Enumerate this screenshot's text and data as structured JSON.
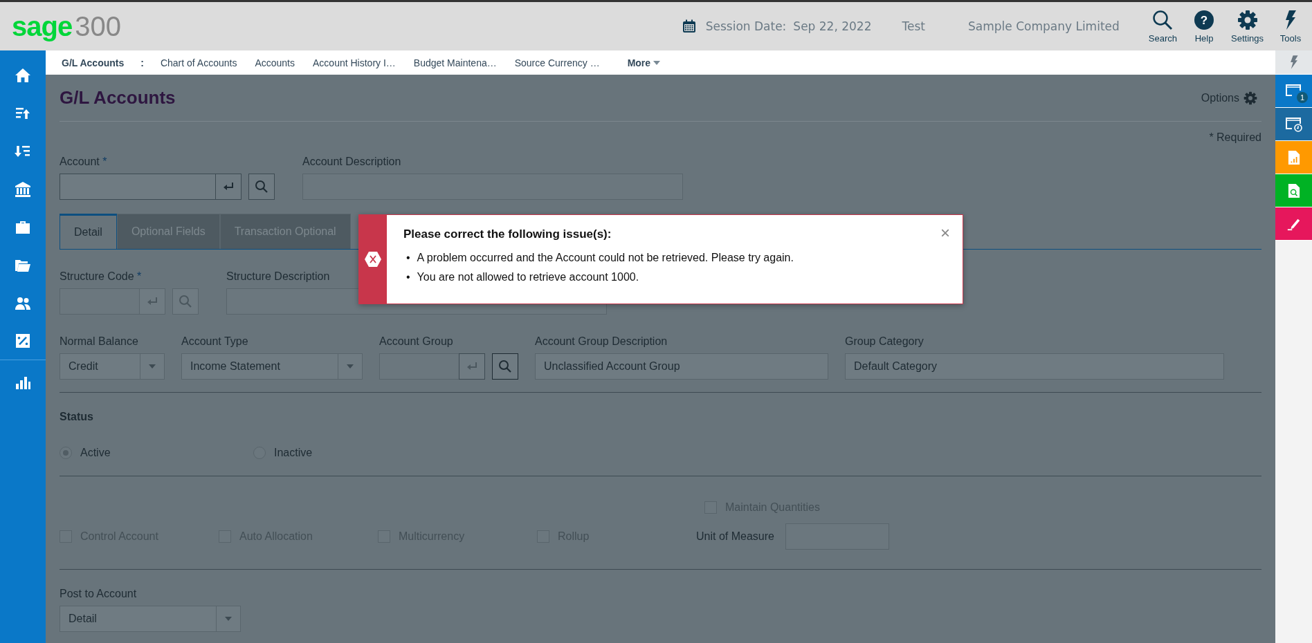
{
  "logo": {
    "brand": "sage",
    "product": "300"
  },
  "header": {
    "session_label": "Session Date:",
    "session_date": "Sep 22, 2022",
    "database": "Test",
    "company": "Sample Company Limited",
    "tools": [
      {
        "kind": "search",
        "label": "Search"
      },
      {
        "kind": "help",
        "label": "Help",
        "glyph": "?"
      },
      {
        "kind": "settings",
        "label": "Settings"
      },
      {
        "kind": "tools",
        "label": "Tools"
      }
    ]
  },
  "nav": {
    "module": "G/L Accounts",
    "separator": ":",
    "links": [
      "Chart of Accounts",
      "Accounts",
      "Account History I…",
      "Budget Maintena…",
      "Source Currency …"
    ],
    "more": "More"
  },
  "sidebar": {
    "items": [
      {
        "kind": "home"
      },
      {
        "kind": "upload"
      },
      {
        "kind": "download"
      },
      {
        "kind": "bank"
      },
      {
        "kind": "briefcase"
      },
      {
        "kind": "folders"
      },
      {
        "kind": "people"
      },
      {
        "kind": "percent"
      },
      {
        "kind": "chart"
      }
    ]
  },
  "right_panel": {
    "items": [
      {
        "kind": "bolt",
        "color": "#e4e7e9"
      },
      {
        "kind": "window",
        "color": "#0a78c8",
        "badge": "1"
      },
      {
        "kind": "window-clock",
        "color": "#1c6aa0"
      },
      {
        "kind": "report",
        "color": "#ff9900"
      },
      {
        "kind": "inquiry",
        "color": "#00b224"
      },
      {
        "kind": "pen",
        "color": "#e6175c"
      }
    ]
  },
  "page": {
    "title": "G/L Accounts",
    "options": "Options",
    "required_note": "* Required"
  },
  "account": {
    "label": "Account",
    "required": "*",
    "description_label": "Account Description"
  },
  "tabs": [
    {
      "label": "Detail",
      "selected": true
    },
    {
      "label": "Optional Fields",
      "selected": false
    },
    {
      "label": "Transaction Optional",
      "selected": false
    }
  ],
  "structure": {
    "code_label": "Structure Code",
    "required": "*",
    "description_label": "Structure Description"
  },
  "row": {
    "normal_balance": {
      "label": "Normal Balance",
      "value": "Credit"
    },
    "account_type": {
      "label": "Account Type",
      "value": "Income Statement"
    },
    "account_group": {
      "label": "Account Group"
    },
    "group_description": {
      "label": "Account Group Description",
      "value": "Unclassified Account Group"
    },
    "group_category": {
      "label": "Group Category",
      "value": "Default Category"
    }
  },
  "status": {
    "heading": "Status",
    "options": [
      {
        "label": "Active",
        "selected": true
      },
      {
        "label": "Inactive",
        "selected": false
      }
    ]
  },
  "flags": [
    {
      "label": "Control Account",
      "checked": false,
      "disabled": true
    },
    {
      "label": "Auto Allocation",
      "checked": false,
      "disabled": true
    },
    {
      "label": "Multicurrency",
      "checked": false,
      "disabled": true
    },
    {
      "label": "Rollup",
      "checked": false,
      "disabled": true
    }
  ],
  "quantities": {
    "label": "Maintain Quantities",
    "checked": false,
    "disabled": true,
    "unit_label": "Unit of Measure"
  },
  "post_to": {
    "label": "Post to Account",
    "value": "Detail"
  },
  "dialog": {
    "title": "Please correct the following issue(s):",
    "close": "×",
    "bullet": "•",
    "messages": [
      "A problem occurred and the Account could not be retrieved. Please try again.",
      "You are not allowed to retrieve account 1000."
    ]
  }
}
